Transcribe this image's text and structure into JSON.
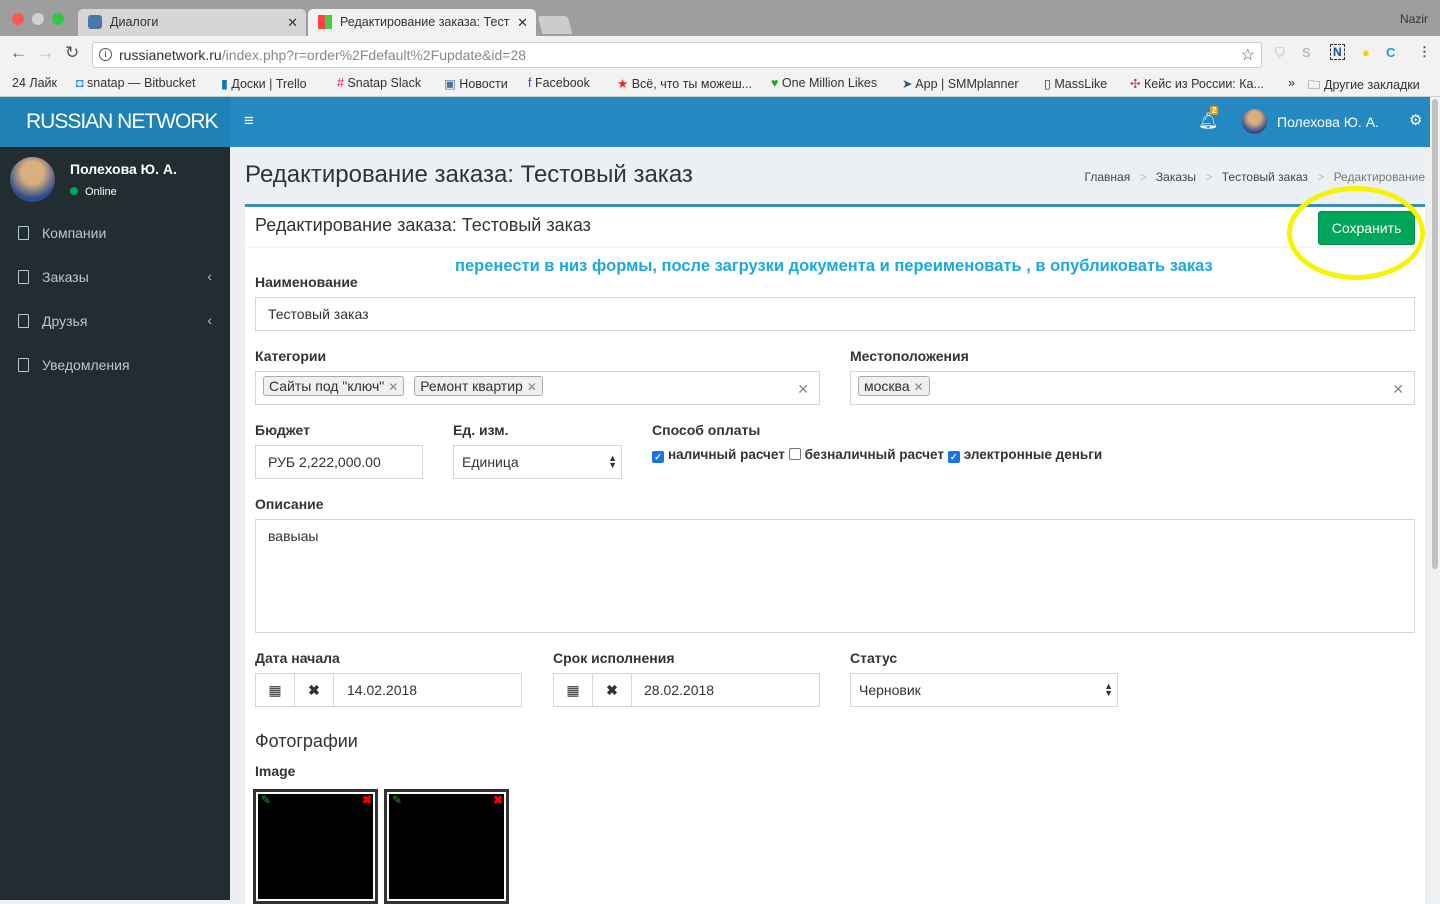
{
  "browser": {
    "tabs": [
      {
        "title": "Диалоги",
        "active": false
      },
      {
        "title": "Редактирование заказа: Тест",
        "active": true
      }
    ],
    "profile": "Nazir",
    "url_host": "russianetwork.ru",
    "url_path": "/index.php?r=order%2Fdefault%2Fupdate&id=28",
    "bookmarks": [
      "24 Лайк",
      "snatap — Bitbucket",
      "Доски | Trello",
      "Snatap Slack",
      "Новости",
      "Facebook",
      "Всё, что ты можеш...",
      "One Million Likes",
      "App | SMMplanner",
      "MassLike",
      "Кейс из России: Ка..."
    ],
    "other_bookmarks": "Другие закладки",
    "more": "»"
  },
  "header": {
    "logo": "RUSSIAN NETWORK",
    "notif_count": "2",
    "user": "Полехова Ю. А.",
    "accent": "#2389c0"
  },
  "sidebar": {
    "user": "Полехова Ю. А.",
    "status": "Online",
    "items": [
      {
        "label": "Компании",
        "sub": false
      },
      {
        "label": "Заказы",
        "sub": true
      },
      {
        "label": "Друзья",
        "sub": true
      },
      {
        "label": "Уведомления",
        "sub": false
      }
    ]
  },
  "page": {
    "title": "Редактирование заказа: Тестовый заказ",
    "breadcrumb": [
      "Главная",
      "Заказы",
      "Тестовый заказ",
      "Редактирование"
    ]
  },
  "form": {
    "box_title": "Редактирование заказа: Тестовый заказ",
    "save": "Сохранить",
    "annotation": "перенести в низ формы, после загрузки документа и переименовать , в опубликовать заказ",
    "name_label": "Наименование",
    "name_value": "Тестовый заказ",
    "categories_label": "Категории",
    "categories": [
      "Сайты под \"ключ\"",
      "Ремонт квартир"
    ],
    "locations_label": "Местоположения",
    "locations": [
      "москва"
    ],
    "budget_label": "Бюджет",
    "budget_value": "РУБ 2,222,000.00",
    "unit_label": "Ед. изм.",
    "unit_value": "Единица",
    "payment_label": "Способ оплаты",
    "payment": [
      {
        "label": "наличный расчет",
        "checked": true
      },
      {
        "label": "безналичный расчет",
        "checked": false
      },
      {
        "label": "электронные деньги",
        "checked": true
      }
    ],
    "description_label": "Описание",
    "description_value": "вавыаы",
    "start_label": "Дата начала",
    "start_value": "14.02.2018",
    "due_label": "Срок исполнения",
    "due_value": "28.02.2018",
    "status_label": "Статус",
    "status_value": "Черновик",
    "photos_title": "Фотографии",
    "image_label": "Image"
  }
}
